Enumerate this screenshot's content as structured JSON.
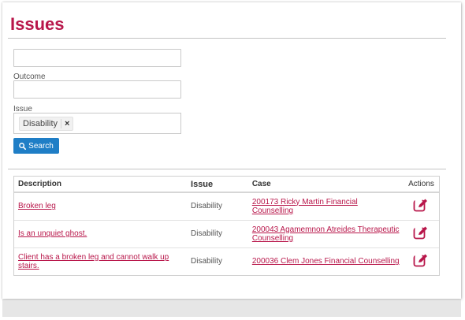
{
  "page": {
    "title": "Issues"
  },
  "filters": {
    "first_field": {
      "value": "",
      "placeholder": ""
    },
    "outcome": {
      "label": "Outcome",
      "value": ""
    },
    "issue": {
      "label": "Issue",
      "selected": [
        "Disability"
      ],
      "remove_glyph": "×"
    },
    "search_button": {
      "label": "Search",
      "icon": "search-icon"
    }
  },
  "table": {
    "headers": {
      "description": "Description",
      "issue": "Issue",
      "case": "Case",
      "actions": "Actions"
    },
    "rows": [
      {
        "description": "Broken leg",
        "issue": "Disability",
        "case": "200173 Ricky Martin Financial Counselling",
        "action_icon": "edit-icon"
      },
      {
        "description": "Is an unquiet ghost.",
        "issue": "Disability",
        "case": "200043 Agamemnon Atreides Therapeutic Counselling",
        "action_icon": "edit-icon"
      },
      {
        "description": "Client has a broken leg and cannot walk up stairs.",
        "issue": "Disability",
        "case": "200036 Clem Jones Financial Counselling",
        "action_icon": "edit-icon"
      }
    ]
  },
  "colors": {
    "brand": "#b8164a",
    "button": "#1f7ec6"
  }
}
